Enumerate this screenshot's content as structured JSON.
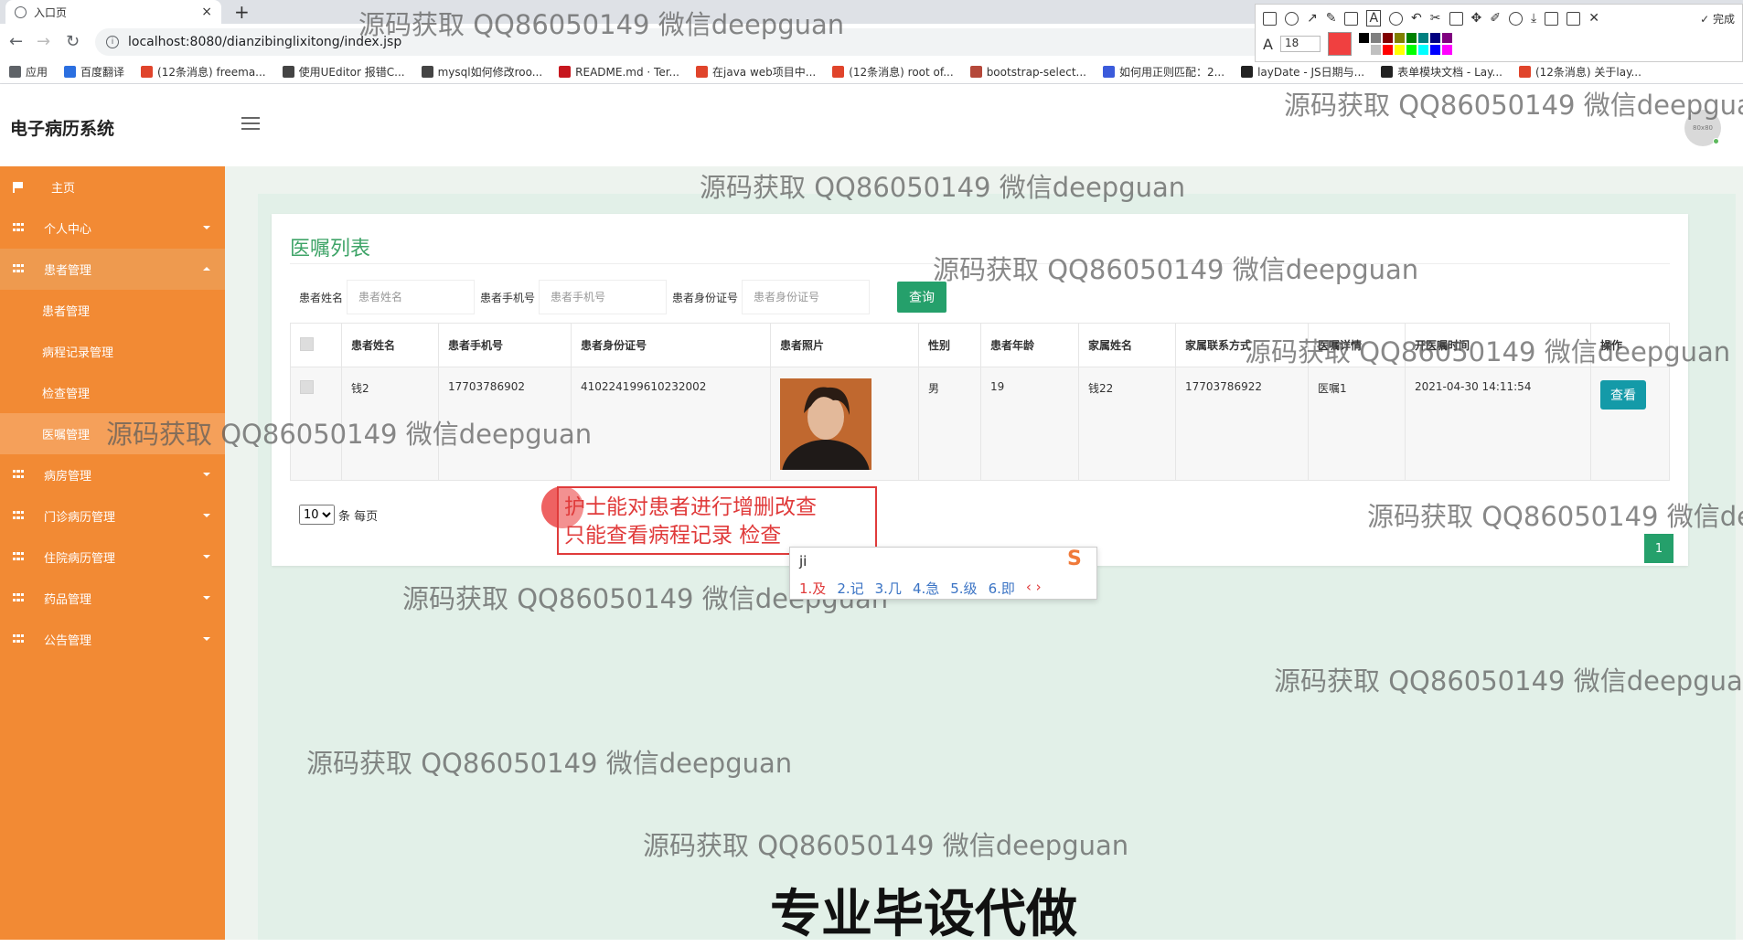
{
  "browser": {
    "tab_title": "入口页",
    "tab_close": "×",
    "new_tab": "+",
    "url": "localhost:8080/dianzibinglixitong/index.jsp",
    "bookmarks": [
      {
        "label": "应用",
        "color": "#5f6368"
      },
      {
        "label": "百度翻译",
        "color": "#2b6fe0"
      },
      {
        "label": "(12条消息) freema...",
        "color": "#e0442b"
      },
      {
        "label": "使用UEditor 报错C...",
        "color": "#444444"
      },
      {
        "label": "mysql如何修改roo...",
        "color": "#444444"
      },
      {
        "label": "README.md · Ter...",
        "color": "#c7161e"
      },
      {
        "label": "在java web项目中...",
        "color": "#e0442b"
      },
      {
        "label": "(12条消息) root of...",
        "color": "#e0442b"
      },
      {
        "label": "bootstrap-select...",
        "color": "#b5483a"
      },
      {
        "label": "如何用正则匹配：2...",
        "color": "#3b5bdb"
      },
      {
        "label": "layDate - JS日期与...",
        "color": "#222222"
      },
      {
        "label": "表单模块文档 - Lay...",
        "color": "#222222"
      },
      {
        "label": "(12条消息) 关于lay...",
        "color": "#e0442b"
      }
    ],
    "annotation_toolbar": {
      "done_label": "✓ 完成",
      "font_size": "18",
      "active_color": "#f04040",
      "swatches": [
        "#000000",
        "#808080",
        "#800000",
        "#808000",
        "#008000",
        "#008080",
        "#000080",
        "#800080",
        "#ffffff",
        "#c0c0c0",
        "#ff0000",
        "#ffff00",
        "#00ff00",
        "#00ffff",
        "#0000ff",
        "#ff00ff"
      ]
    }
  },
  "app": {
    "title": "电子病历系统",
    "avatar_text": "80x80"
  },
  "sidebar": {
    "home": "主页",
    "items": [
      {
        "label": "个人中心",
        "expanded": false
      },
      {
        "label": "患者管理",
        "expanded": true
      }
    ],
    "sub_items": [
      "患者管理",
      "病程记录管理",
      "检查管理",
      "医嘱管理"
    ],
    "active_sub": "医嘱管理",
    "more_items": [
      "病房管理",
      "门诊病历管理",
      "住院病历管理",
      "药品管理",
      "公告管理"
    ]
  },
  "page": {
    "title": "医嘱列表",
    "search": {
      "name_label": "患者姓名",
      "name_placeholder": "患者姓名",
      "phone_label": "患者手机号",
      "phone_placeholder": "患者手机号",
      "id_label": "患者身份证号",
      "id_placeholder": "患者身份证号",
      "query_button": "查询"
    },
    "table": {
      "columns": [
        "患者姓名",
        "患者手机号",
        "患者身份证号",
        "患者照片",
        "性别",
        "患者年龄",
        "家属姓名",
        "家属联系方式",
        "医嘱详情",
        "开医嘱时间",
        "操作"
      ],
      "rows": [
        {
          "name": "钱2",
          "phone": "17703786902",
          "id_number": "410224199610232002",
          "gender": "男",
          "age": "19",
          "family_name": "钱22",
          "family_phone": "17703786922",
          "order_detail": "医嘱1",
          "order_time": "2021-04-30 14:11:54",
          "action": "查看"
        }
      ]
    },
    "pagination": {
      "page_size": "10",
      "page_size_suffix": "条 每页",
      "current_page": "1"
    }
  },
  "overlays": {
    "watermark": "源码获取 QQ86050149 微信deepguan",
    "slogan": "专业毕设代做",
    "note_line1": "护士能对患者进行增删改查",
    "note_line2": "只能查看病程记录 检查",
    "ime_input": "ji",
    "ime_candidates": [
      "1.及",
      "2.记",
      "3.几",
      "4.急",
      "5.级",
      "6.即"
    ],
    "ime_nav": "‹ ›",
    "ime_logo": "S"
  }
}
